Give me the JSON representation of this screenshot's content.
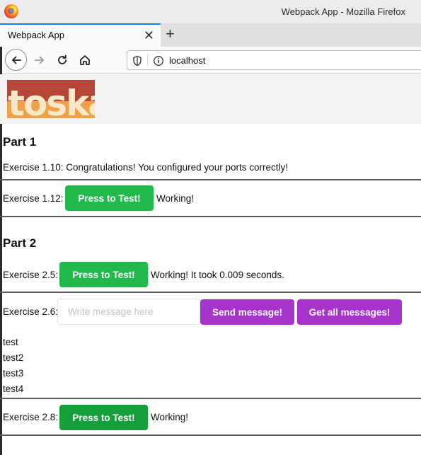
{
  "window": {
    "title": "Webpack App - Mozilla Firefox"
  },
  "tab": {
    "title": "Webpack App",
    "close": "✕",
    "new_tab": "+"
  },
  "nav": {
    "url": "localhost"
  },
  "logo": {
    "text": "toska",
    "colors": {
      "dark": "#b5473a",
      "orange": "#f0a047",
      "cream": "#f7e8c9"
    }
  },
  "part1": {
    "heading": "Part 1",
    "ex110": "Exercise 1.10: Congratulations! You configured your ports correctly!",
    "ex112": {
      "label": "Exercise 1.12:",
      "button": "Press to Test!",
      "status": "Working!"
    }
  },
  "part2": {
    "heading": "Part 2",
    "ex25": {
      "label": "Exercise 2.5:",
      "button": "Press to Test!",
      "status": "Working! It took 0.009 seconds."
    },
    "ex26": {
      "label": "Exercise 2.6:",
      "placeholder": "Write message here",
      "send_button": "Send message!",
      "get_button": "Get all messages!",
      "messages": [
        "test",
        "test2",
        "test3",
        "test4"
      ]
    },
    "ex28": {
      "label": "Exercise 2.8:",
      "button": "Press to Test!",
      "status": "Working!"
    }
  },
  "colors": {
    "green": "#21b94c",
    "green_pressed": "#159f3a",
    "purple": "#a633cc",
    "tab_accent": "#0a84ff"
  }
}
